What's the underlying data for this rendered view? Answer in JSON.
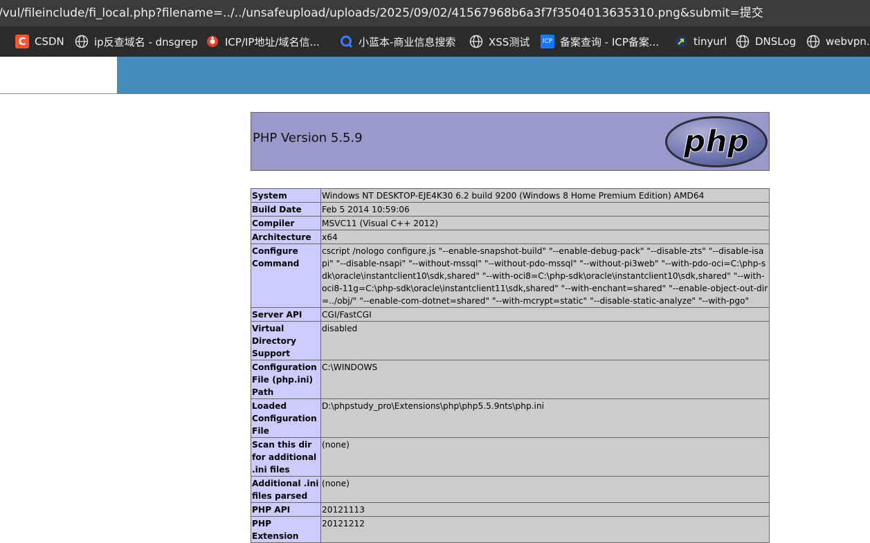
{
  "browser": {
    "url": "/vul/fileinclude/fi_local.php?filename=../../unsafeupload/uploads/2025/09/02/41567968b6a3f7f3504013635310.png&submit=提交",
    "bookmarks": [
      {
        "label": "CSDN",
        "icon": "csdn-icon"
      },
      {
        "label": "ip反查域名 - dnsgrep",
        "icon": "globe-icon"
      },
      {
        "label": "ICP/IP地址/域名信...",
        "icon": "icp-search-icon"
      },
      {
        "label": "小蓝本-商业信息搜索",
        "icon": "xiaolanben-icon"
      },
      {
        "label": "XSS测试",
        "icon": "globe-icon"
      },
      {
        "label": "备案查询 - ICP备案...",
        "icon": "icp-icon"
      },
      {
        "label": "tinyurl",
        "icon": "tinyurl-icon"
      },
      {
        "label": "DNSLog",
        "icon": "globe-icon"
      },
      {
        "label": "webvpn.l",
        "icon": "globe-icon"
      }
    ]
  },
  "phpinfo": {
    "version_title": "PHP Version 5.5.9",
    "logo_text": "php",
    "rows": [
      {
        "key": "System",
        "value": "Windows NT DESKTOP-EJE4K30 6.2 build 9200 (Windows 8 Home Premium Edition) AMD64"
      },
      {
        "key": "Build Date",
        "value": "Feb 5 2014 10:59:06"
      },
      {
        "key": "Compiler",
        "value": "MSVC11 (Visual C++ 2012)"
      },
      {
        "key": "Architecture",
        "value": "x64"
      },
      {
        "key": "Configure Command",
        "value": "cscript /nologo configure.js \"--enable-snapshot-build\" \"--enable-debug-pack\" \"--disable-zts\" \"--disable-isapi\" \"--disable-nsapi\" \"--without-mssql\" \"--without-pdo-mssql\" \"--without-pi3web\" \"--with-pdo-oci=C:\\php-sdk\\oracle\\instantclient10\\sdk,shared\" \"--with-oci8=C:\\php-sdk\\oracle\\instantclient10\\sdk,shared\" \"--with-oci8-11g=C:\\php-sdk\\oracle\\instantclient11\\sdk,shared\" \"--with-enchant=shared\" \"--enable-object-out-dir=../obj/\" \"--enable-com-dotnet=shared\" \"--with-mcrypt=static\" \"--disable-static-analyze\" \"--with-pgo\""
      },
      {
        "key": "Server API",
        "value": "CGI/FastCGI"
      },
      {
        "key": "Virtual Directory Support",
        "value": "disabled"
      },
      {
        "key": "Configuration File (php.ini) Path",
        "value": "C:\\WINDOWS"
      },
      {
        "key": "Loaded Configuration File",
        "value": "D:\\phpstudy_pro\\Extensions\\php\\php5.5.9nts\\php.ini"
      },
      {
        "key": "Scan this dir for additional .ini files",
        "value": "(none)"
      },
      {
        "key": "Additional .ini files parsed",
        "value": "(none)"
      },
      {
        "key": "PHP API",
        "value": "20121113"
      },
      {
        "key": "PHP Extension",
        "value": "20121212"
      }
    ]
  },
  "colors": {
    "header_bg": "#9999cc",
    "key_bg": "#ccccff",
    "value_bg": "#cccccc",
    "band_blue": "#448cba"
  }
}
